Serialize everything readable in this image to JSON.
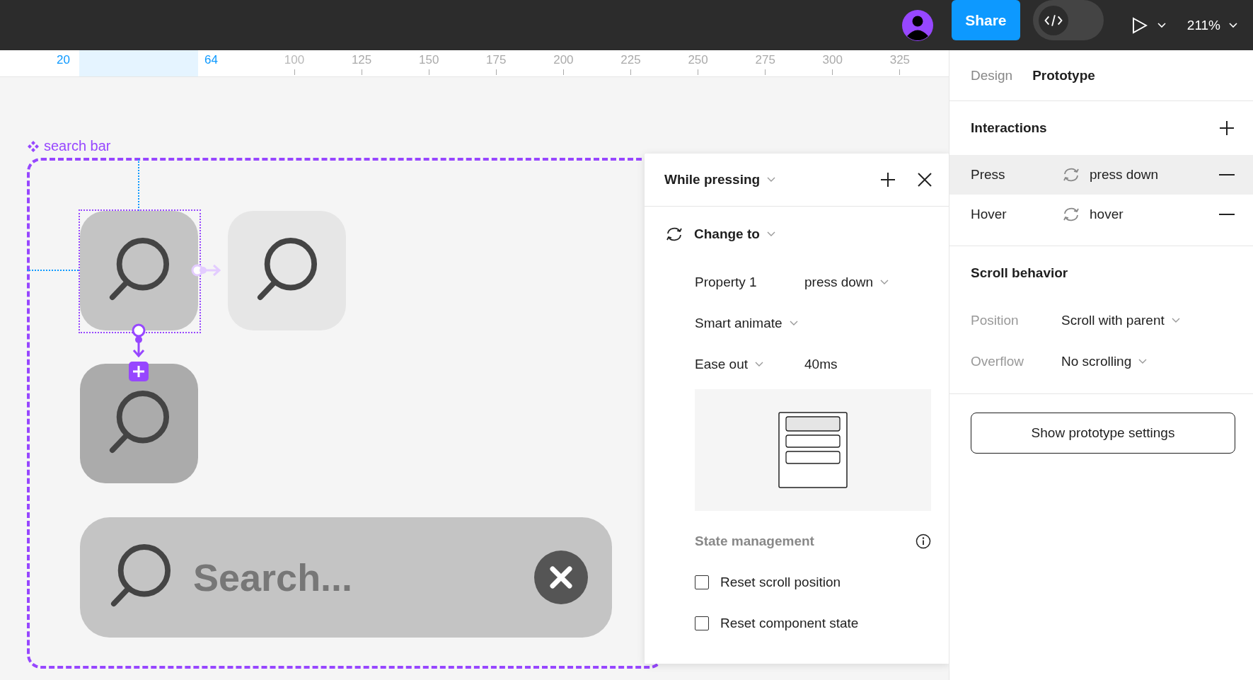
{
  "toolbar": {
    "share_button": "Share",
    "code_toggle": {
      "on": false
    },
    "zoom": "211%"
  },
  "ruler": {
    "selection_start": "20",
    "selection_end": "64",
    "ticks": [
      "100",
      "125",
      "150",
      "175",
      "200",
      "225",
      "250",
      "275",
      "300",
      "325"
    ]
  },
  "canvas": {
    "frame_label": "search bar",
    "search_text": "Search..."
  },
  "interaction_popup": {
    "trigger": "While pressing",
    "action": "Change to",
    "property": {
      "label": "Property 1",
      "value": "press down"
    },
    "animation": "Smart animate",
    "easing": "Ease out",
    "duration": "40ms",
    "state_management": {
      "title": "State management",
      "options": [
        {
          "label": "Reset scroll position",
          "checked": false
        },
        {
          "label": "Reset component state",
          "checked": false
        }
      ]
    }
  },
  "panel": {
    "tabs": [
      {
        "label": "Design",
        "selected": false
      },
      {
        "label": "Prototype",
        "selected": true
      }
    ],
    "interactions": {
      "title": "Interactions",
      "items": [
        {
          "trigger": "Press",
          "target": "press down",
          "selected": true
        },
        {
          "trigger": "Hover",
          "target": "hover",
          "selected": false
        }
      ]
    },
    "scroll_behavior": {
      "title": "Scroll behavior",
      "fields": [
        {
          "label": "Position",
          "value": "Scroll with parent"
        },
        {
          "label": "Overflow",
          "value": "No scrolling"
        }
      ]
    },
    "settings_button": "Show prototype settings"
  }
}
